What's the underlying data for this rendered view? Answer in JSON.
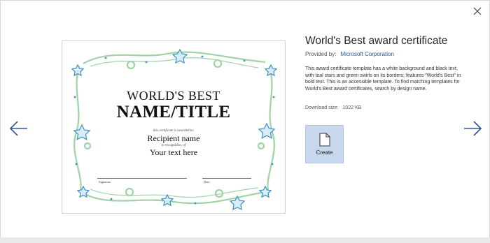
{
  "template": {
    "title": "World's Best award certificate",
    "provided_by_label": "Provided by:",
    "provider": "Microsoft Corporation",
    "description": "This award certificate template has a white background and black text, with teal stars and green swirls on its borders; features \"World's Best\" in bold text. This is an accessible template. To find matching templates for World's Best award certificates, search by design name.",
    "download_size_label": "Download size:",
    "download_size": "1022 KB",
    "create_label": "Create"
  },
  "certificate": {
    "heading": "WORLD'S BEST",
    "name_title": "NAME/TITLE",
    "awarded_to": "this certificate is awarded to:",
    "recipient": "Recipient name",
    "recognition": "in recognition, of",
    "your_text": "Your text here",
    "signature_label": "Signature",
    "date_label": "Date"
  },
  "icons": {
    "close": "close-icon",
    "prev": "arrow-left-icon",
    "next": "arrow-right-icon",
    "create": "document-icon"
  },
  "colors": {
    "star_teal": "#3a8fc0",
    "swirl_green": "#9fd3a6",
    "create_bg": "#c7d7ed",
    "provider_link": "#2b5797"
  }
}
